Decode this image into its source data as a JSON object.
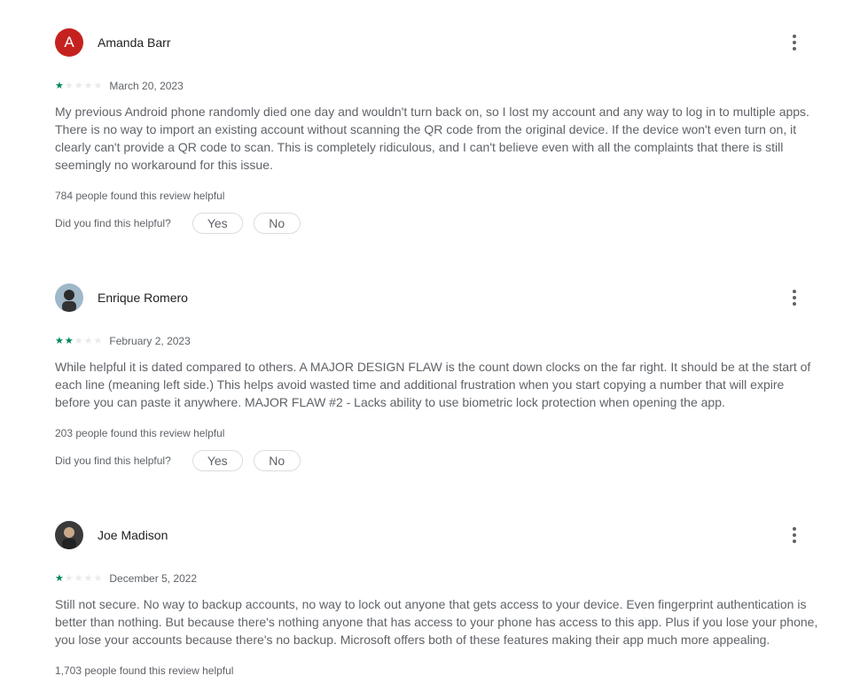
{
  "colors": {
    "star": "#01875f",
    "avatar_a": "#c5221f"
  },
  "helpful_prompt": "Did you find this helpful?",
  "yes_label": "Yes",
  "no_label": "No",
  "reviews": [
    {
      "author": "Amanda Barr",
      "initial": "A",
      "rating": 1,
      "date": "March 20, 2023",
      "text": "My previous Android phone randomly died one day and wouldn't turn back on, so I lost my account and any way to log in to multiple apps. There is no way to import an existing account without scanning the QR code from the original device. If the device won't even turn on, it clearly can't provide a QR code to scan. This is completely ridiculous, and I can't believe even with all the complaints that there is still seemingly no workaround for this issue.",
      "helpful": "784 people found this review helpful"
    },
    {
      "author": "Enrique Romero",
      "initial": "",
      "rating": 2,
      "date": "February 2, 2023",
      "text": "While helpful it is dated compared to others. A MAJOR DESIGN FLAW is the count down clocks on the far right. It should be at the start of each line (meaning left side.) This helps avoid wasted time and additional frustration when you start copying a number that will expire before you can paste it anywhere. MAJOR FLAW #2 - Lacks ability to use biometric lock protection when opening the app.",
      "helpful": "203 people found this review helpful"
    },
    {
      "author": "Joe Madison",
      "initial": "",
      "rating": 1,
      "date": "December 5, 2022",
      "text": "Still not secure. No way to backup accounts, no way to lock out anyone that gets access to your device. Even fingerprint authentication is better than nothing. But because there's nothing anyone that has access to your phone has access to this app. Plus if you lose your phone, you lose your accounts because there's no backup. Microsoft offers both of these features making their app much more appealing.",
      "helpful": "1,703 people found this review helpful"
    }
  ]
}
